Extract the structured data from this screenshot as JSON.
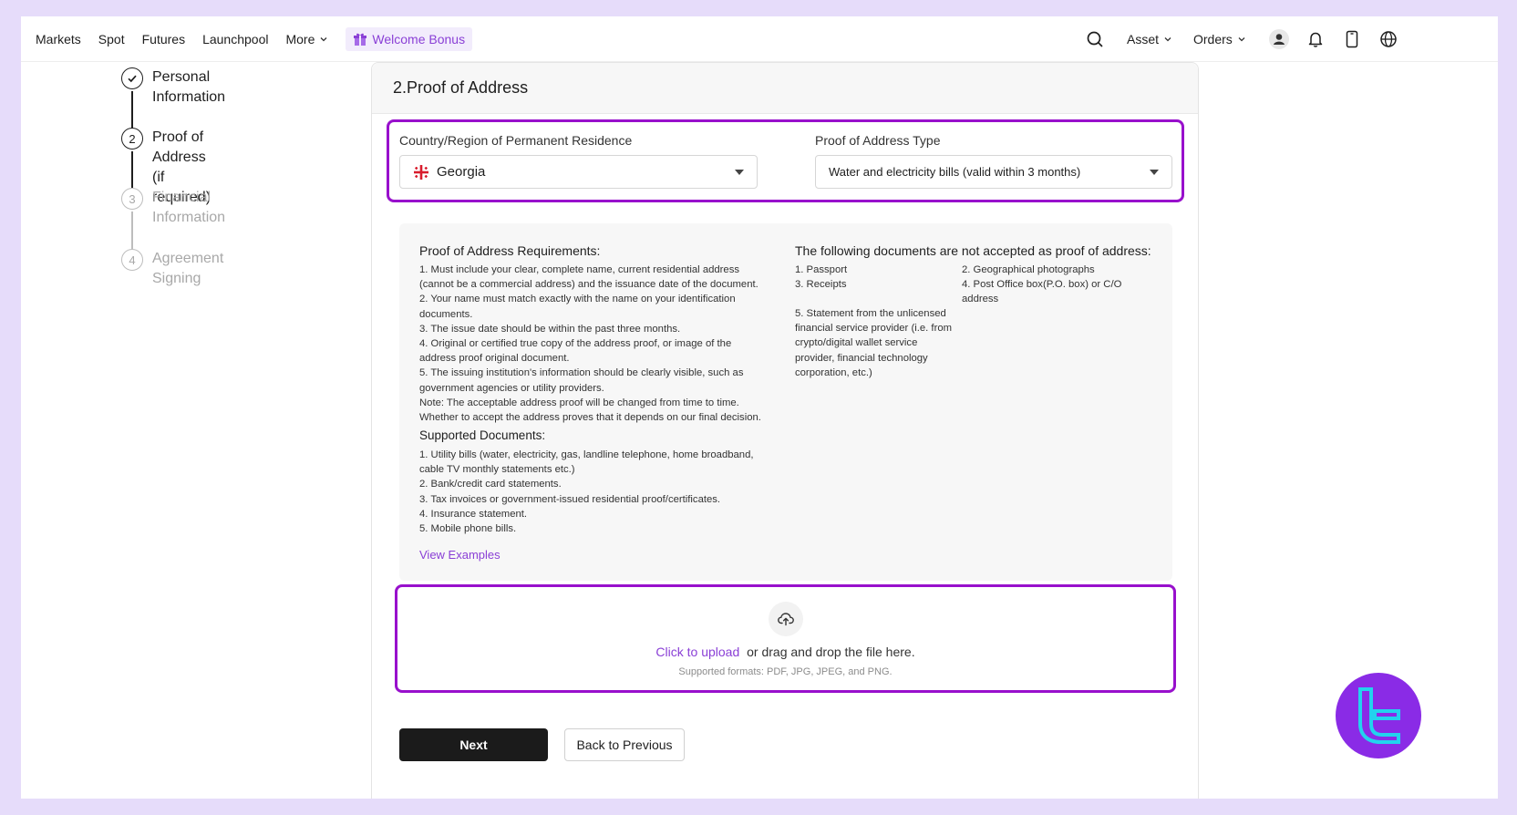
{
  "nav": {
    "items": [
      "Markets",
      "Spot",
      "Futures",
      "Launchpool",
      "More"
    ],
    "bonus_label": "Welcome Bonus",
    "asset_label": "Asset",
    "orders_label": "Orders"
  },
  "steps": [
    {
      "number": "",
      "label": "Personal Information",
      "sublabel": "",
      "state": "done"
    },
    {
      "number": "2",
      "label": "Proof of Address",
      "sublabel": "(if required)",
      "state": "active"
    },
    {
      "number": "3",
      "label": "Financial Information",
      "sublabel": "",
      "state": "pending"
    },
    {
      "number": "4",
      "label": "Agreement Signing",
      "sublabel": "",
      "state": "pending"
    }
  ],
  "card": {
    "title": "2.Proof of Address",
    "country_label": "Country/Region of Permanent Residence",
    "country_value": "Georgia",
    "type_label": "Proof of Address Type",
    "type_value": "Water and electricity bills (valid within 3 months)"
  },
  "requirements": {
    "title": "Proof of Address Requirements:",
    "lines": [
      "1. Must include your clear, complete name, current residential address",
      "(cannot be a commercial address) and the issuance date of the document.",
      "2. Your name must match exactly with the name on your identification",
      "documents.",
      "3. The issue date should be within the past three months.",
      "4. Original or certified true copy of the address proof, or image of the",
      "address proof original document.",
      "5. The issuing institution's information should be clearly visible, such as",
      "government agencies or utility providers.",
      "Note: The acceptable address proof will be changed from time to time.",
      "Whether to accept the address proves that it depends on our final decision."
    ],
    "supported_title": "Supported Documents:",
    "supported_lines": [
      "1. Utility bills (water, electricity, gas, landline telephone, home broadband,",
      "cable TV monthly statements etc.)",
      "2. Bank/credit card statements.",
      "3. Tax invoices or government-issued residential proof/certificates.",
      "4. Insurance statement.",
      "5. Mobile phone bills."
    ],
    "view_examples": "View Examples"
  },
  "not_accepted": {
    "title": "The following documents are not accepted as proof of address:",
    "col1": [
      "1. Passport",
      "3. Receipts"
    ],
    "col2": [
      "2. Geographical photographs",
      "4. Post Office box(P.O. box) or C/O",
      "address"
    ],
    "item5": [
      "5. Statement from the unlicensed",
      "financial service provider (i.e. from",
      "crypto/digital wallet service",
      "provider, financial technology",
      "corporation, etc.)"
    ]
  },
  "upload": {
    "link": "Click to upload",
    "text": "or drag and drop the file here.",
    "hint": "Supported formats: PDF, JPG, JPEG, and PNG."
  },
  "buttons": {
    "next": "Next",
    "back": "Back to Previous"
  },
  "colors": {
    "accent": "#8a3fd6",
    "highlight": "#9810cc",
    "background": "#e6dcfa",
    "primary_button": "#1b1b1b"
  }
}
